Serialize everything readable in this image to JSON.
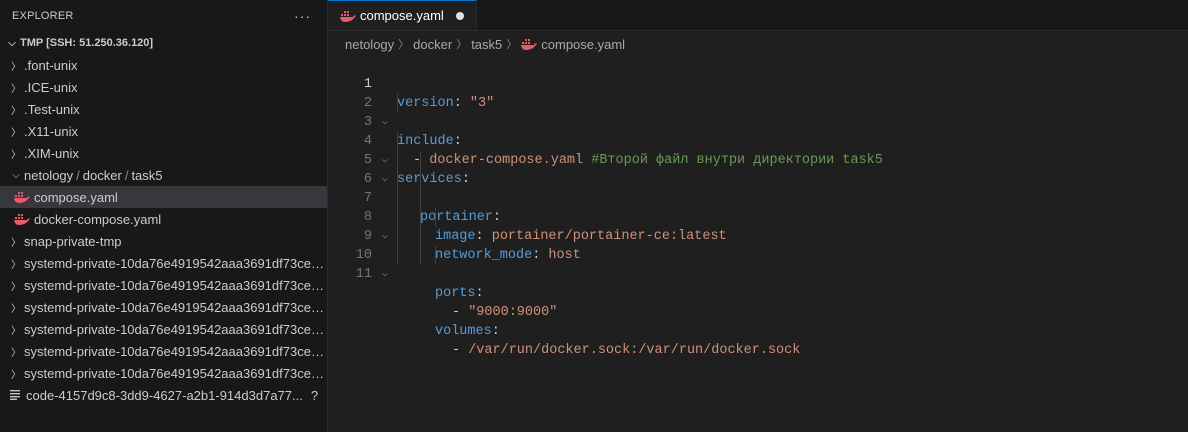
{
  "explorer": {
    "title": "EXPLORER",
    "more": "···",
    "root": "TMP [SSH: 51.250.36.120]",
    "items": [
      {
        "label": ".font-unix"
      },
      {
        "label": ".ICE-unix"
      },
      {
        "label": ".Test-unix"
      },
      {
        "label": ".X11-unix"
      },
      {
        "label": ".XIM-unix"
      }
    ],
    "open_folder": {
      "parts": [
        "netology",
        "docker",
        "task5"
      ]
    },
    "files": [
      {
        "label": "compose.yaml"
      },
      {
        "label": "docker-compose.yaml"
      }
    ],
    "more_items": [
      {
        "label": "snap-private-tmp"
      },
      {
        "label": "systemd-private-10da76e4919542aaa3691df73ced..."
      },
      {
        "label": "systemd-private-10da76e4919542aaa3691df73ced..."
      },
      {
        "label": "systemd-private-10da76e4919542aaa3691df73ced..."
      },
      {
        "label": "systemd-private-10da76e4919542aaa3691df73ced..."
      },
      {
        "label": "systemd-private-10da76e4919542aaa3691df73ced..."
      },
      {
        "label": "systemd-private-10da76e4919542aaa3691df73ced..."
      }
    ],
    "code_file": {
      "label": "code-4157d9c8-3dd9-4627-a2b1-914d3d7a77...",
      "badge": "?"
    }
  },
  "tab": {
    "label": "compose.yaml"
  },
  "breadcrumb": [
    "netology",
    "docker",
    "task5",
    "compose.yaml"
  ],
  "code": {
    "l1": {
      "key": "version",
      "colon": ": ",
      "val": "\"3\""
    },
    "l2": {
      "key": "include",
      "colon": ":"
    },
    "l3": {
      "dash": "- ",
      "val": "docker-compose.yaml ",
      "comment": "#Второй файл внутри директории task5"
    },
    "l4": {
      "key": "services",
      "colon": ":"
    },
    "l5": {
      "key": "portainer",
      "colon": ":"
    },
    "l6": {
      "key": "image",
      "colon": ": ",
      "val": "portainer/portainer-ce:latest"
    },
    "l7": {
      "key": "network_mode",
      "colon": ": ",
      "val": "host"
    },
    "l8": {
      "key": "ports",
      "colon": ":"
    },
    "l9": {
      "dash": "- ",
      "val": "\"9000:9000\""
    },
    "l10": {
      "key": "volumes",
      "colon": ":"
    },
    "l11": {
      "dash": "- ",
      "val": "/var/run/docker.sock:/var/run/docker.sock"
    }
  },
  "line_numbers": [
    "1",
    "2",
    "3",
    "4",
    "5",
    "6",
    "7",
    "8",
    "9",
    "10",
    "11"
  ],
  "colors": {
    "accent": "#0078d4",
    "key": "#569cd6",
    "string": "#ce9178",
    "comment": "#6a9955",
    "whale": "#e85a6b"
  }
}
